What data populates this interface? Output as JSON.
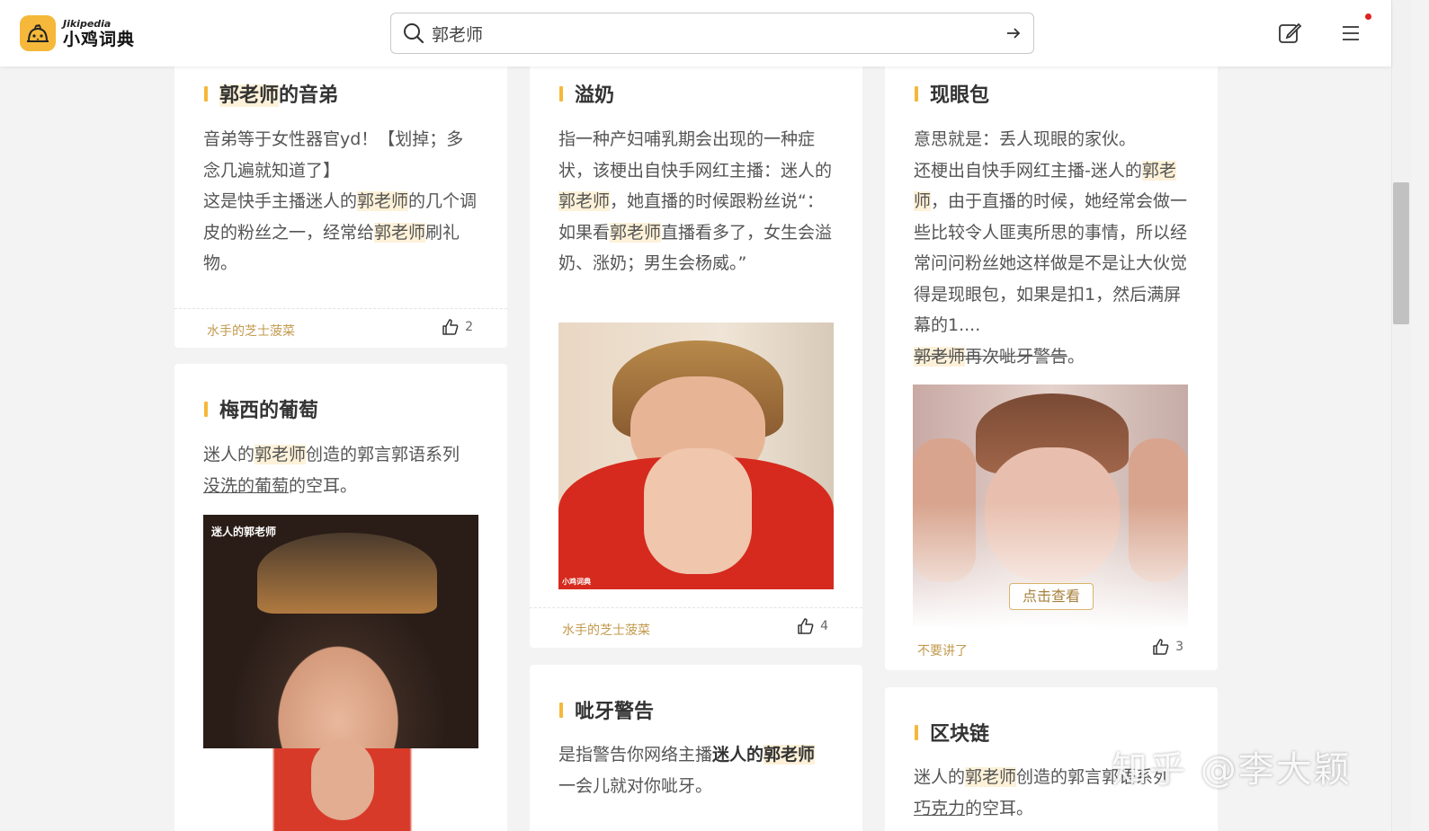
{
  "header": {
    "logo_en": "Jikipedia",
    "logo_cn": "小鸡词典",
    "search_value": "郭老师"
  },
  "cards": [
    {
      "title_hl": "郭老师",
      "title_rest": "的音弟",
      "body": {
        "p1": "音弟等于女性器官yd！【划掉；多念几遍就知道了】",
        "p2a": "这是快手主播迷人的",
        "hl1": "郭老师",
        "p2b": "的几个调皮的粉丝之一，经常给",
        "hl2": "郭老师",
        "p2c": "刷礼物。"
      },
      "author": "水手的芝士菠菜",
      "likes": "2"
    },
    {
      "title": "梅西的葡萄",
      "body": {
        "a": "迷人的",
        "hl1": "郭老师",
        "b": "创造的郭言郭语系列",
        "link": "没洗的葡萄",
        "c": "的空耳。"
      },
      "photo_caption": "迷人的郭老师"
    },
    {
      "title": "溢奶",
      "body": {
        "a": "指一种产妇哺乳期会出现的一种症状，该梗出自快手网红主播：迷人的",
        "hl1": "郭老师",
        "b": "，她直播的时候跟粉丝说“：如果看",
        "hl2": "郭老师",
        "c": "直播看多了，女生会溢奶、涨奶；男生会杨威。”"
      },
      "photo_caption": "小鸡词典",
      "author": "水手的芝士菠菜",
      "likes": "4"
    },
    {
      "title": "呲牙警告",
      "body": {
        "a": "是指警告你网络主播",
        "bold": "迷人的",
        "hl1": "郭老师",
        "b": "一会儿就对你呲牙。"
      }
    },
    {
      "title": "现眼包",
      "body": {
        "p1": "意思就是：丢人现眼的家伙。",
        "a": "还梗出自快手网红主播-迷人的",
        "hl1": "郭老师",
        "b": "，由于直播的时候，她经常会做一些比较令人匪夷所思的事情，所以经常问问粉丝她这样做是不是让大伙觉得是现眼包，如果是扣1，然后满屏幕的1....",
        "s_hl": "郭老师",
        "s_rest": "再次呲牙警告",
        "s_end": "。"
      },
      "view_button": "点击查看",
      "author": "不要讲了",
      "likes": "3"
    },
    {
      "title": "区块链",
      "body": {
        "a": "迷人的",
        "hl1": "郭老师",
        "b": "创造的郭言郭语系列",
        "link": "巧克力",
        "c": "的空耳。"
      }
    }
  ],
  "watermark": "知乎 @李大颖",
  "colors": {
    "accent": "#f5b83a",
    "highlight": "#fdf1d8",
    "author": "#c39a4e"
  }
}
